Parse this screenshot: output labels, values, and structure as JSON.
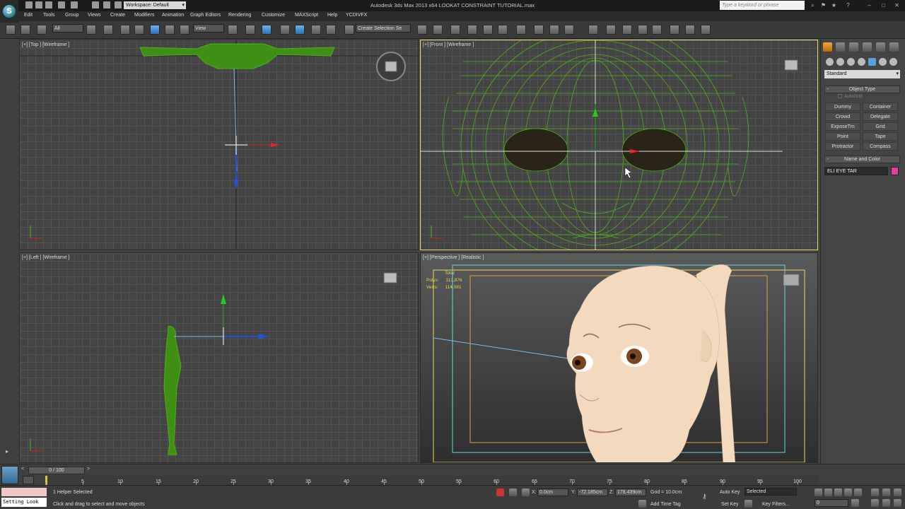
{
  "window": {
    "title": "Autodesk 3ds Max  2013 x64      LOOKAT CONSTRAINT TUTORIAL.max",
    "workspace": "Workspace: Default",
    "search_placeholder": "Type a keyword or phrase",
    "logo_letter": "S"
  },
  "menu": [
    "Edit",
    "Tools",
    "Group",
    "Views",
    "Create",
    "Modifiers",
    "Animation",
    "Graph Editors",
    "Rendering",
    "Customize",
    "MAXScript",
    "Help",
    "YCDIVFX"
  ],
  "toolbar": {
    "selection_filter": "All",
    "reference_coord": "View",
    "named_selection_placeholder": "Create Selection Se"
  },
  "viewports": {
    "top": {
      "label": "[+] [Top ] [Wireframe ]"
    },
    "front": {
      "label": "[+] [Front ] [Wireframe ]"
    },
    "left": {
      "label": "[+] [Left ] [Wireframe ]"
    },
    "perspective": {
      "label": "[+] [Perspective ] [Realistic ]",
      "stats": {
        "total_label": "Total",
        "polys_label": "Polys:",
        "polys_value": "113,876",
        "verts_label": "Verts:",
        "verts_value": "114,081"
      }
    }
  },
  "command_panel": {
    "category": "Standard",
    "object_type_title": "Object Type",
    "autogrid_label": "AutoGrid",
    "buttons": [
      "Dummy",
      "Container",
      "Crowd",
      "Delegate",
      "ExposeTm",
      "Grid",
      "Point",
      "Tape",
      "Protractor",
      "Compass"
    ],
    "name_and_color_title": "Name and Color",
    "object_name": "ELI EYE TAR",
    "object_color": "#e63ea0"
  },
  "timeline": {
    "slider_text": "0 / 100",
    "ticks": [
      0,
      5,
      10,
      15,
      20,
      25,
      30,
      35,
      40,
      45,
      50,
      55,
      60,
      65,
      70,
      75,
      80,
      85,
      90,
      95,
      100
    ]
  },
  "status": {
    "listener_output": "Setting Look",
    "selection_info": "1 Helper Selected",
    "prompt": "Click and drag to select and move objects",
    "x_label": "X:",
    "x_value": "0.0cm",
    "y_label": "Y:",
    "y_value": "-72.185cm",
    "z_label": "Z:",
    "z_value": "178.439cm",
    "grid": "Grid = 10.0cm",
    "auto_key": "Auto Key",
    "set_key": "Set Key",
    "key_mode": "Selected",
    "key_filters": "Key Filters...",
    "add_time_tag": "Add Time Tag",
    "current_frame": "0"
  },
  "colors": {
    "wire_green": "#4fae1c",
    "active_viewport_border": "#e9d66a",
    "skin": "#f3d9bd"
  }
}
